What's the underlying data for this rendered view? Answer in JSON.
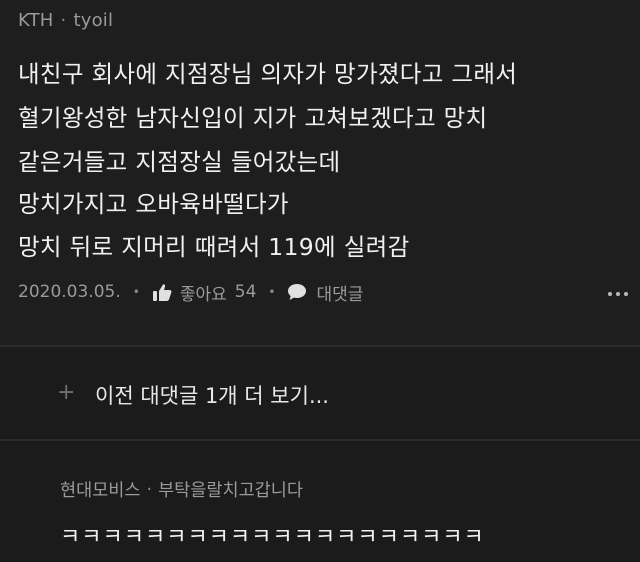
{
  "comment": {
    "author_org": "KTH",
    "author_name": "tyoil",
    "lines": [
      "내친구 회사에 지점장님 의자가 망가졌다고 그래서",
      "혈기왕성한 남자신입이 지가 고쳐보겠다고 망치",
      "같은거들고 지점장실 들어갔는데",
      "망치가지고 오바육바떨다가",
      "망치 뒤로 지머리 때려서 119에 실려감"
    ],
    "date": "2020.03.05.",
    "like_label": "좋아요",
    "like_count": "54",
    "reply_label": "대댓글"
  },
  "prev_replies": {
    "label": "이전 대댓글 1개 더 보기..."
  },
  "reply": {
    "author_org": "현대모비스",
    "author_name": "부탁을랄치고갑니다",
    "body": "ㅋㅋㅋㅋㅋㅋㅋㅋㅋㅋㅋㅋㅋㅋㅋㅋㅋㅋㅋㅋ"
  }
}
